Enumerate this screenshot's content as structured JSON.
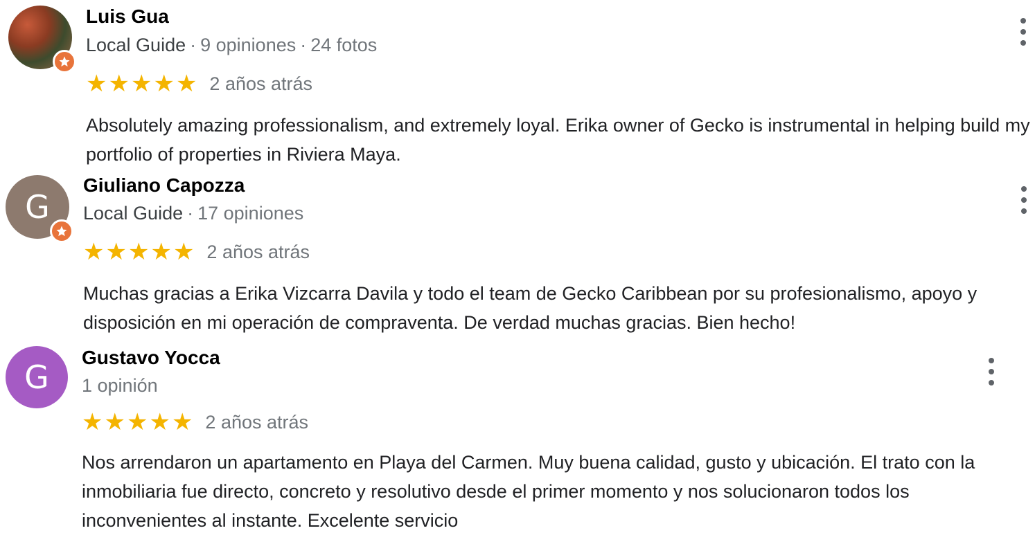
{
  "reviews": [
    {
      "name": "Luis Gua",
      "guide": "Local Guide",
      "reviews_count": "9 opiniones",
      "photos_count": "24 fotos",
      "stars": 5,
      "date": "2 años atrás",
      "text": "Absolutely amazing professionalism, and extremely loyal. Erika owner of Gecko is instrumental in helping build my portfolio of properties in Riviera Maya."
    },
    {
      "name": "Giuliano Capozza",
      "avatar_letter": "G",
      "avatar_color": "#8d7a6e",
      "guide": "Local Guide",
      "reviews_count": "17 opiniones",
      "stars": 5,
      "date": "2 años atrás",
      "text": "Muchas gracias a Erika Vizcarra Davila y todo el team de Gecko Caribbean por su profesionalismo, apoyo y disposición en mi operación de compraventa. De verdad muchas gracias. Bien hecho!"
    },
    {
      "name": "Gustavo Yocca",
      "avatar_letter": "G",
      "avatar_color": "#a55bc4",
      "reviews_count": "1 opinión",
      "stars": 5,
      "date": "2 años atrás",
      "text": "Nos arrendaron un apartamento en Playa del Carmen. Muy buena calidad, gusto y ubicación. El trato con la inmobiliaria fue directo, concreto y resolutivo desde el primer momento y nos solucionaron todos los inconvenientes al instante. Excelente servicio"
    }
  ],
  "icons": {
    "star": "star-icon",
    "menu": "more-vert-icon",
    "badge": "local-guide-badge-icon"
  },
  "colors": {
    "star": "#f4b400",
    "badge": "#e8743b"
  }
}
